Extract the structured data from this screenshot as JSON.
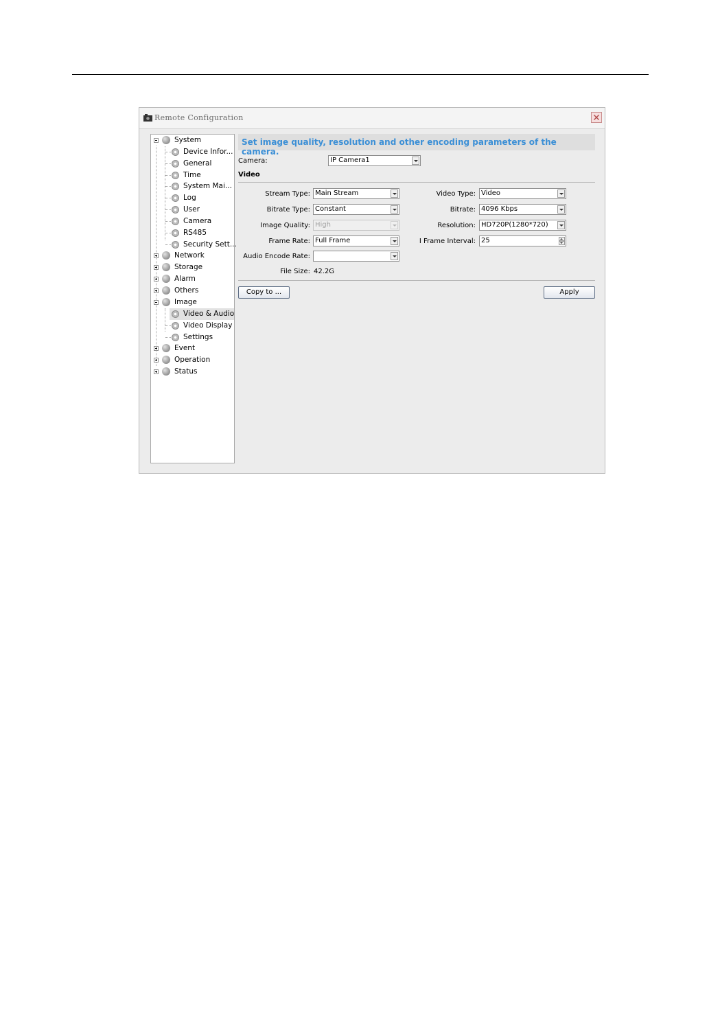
{
  "window": {
    "title": "Remote Configuration"
  },
  "tree": {
    "system": "System",
    "system_children": [
      "Device Infor...",
      "General",
      "Time",
      "System Mai...",
      "Log",
      "User",
      "Camera",
      "RS485",
      "Security Sett..."
    ],
    "network": "Network",
    "storage": "Storage",
    "alarm": "Alarm",
    "others": "Others",
    "image": "Image",
    "image_children": [
      "Video & Audio",
      "Video Display",
      "Settings"
    ],
    "selected": "Video & Audio",
    "event": "Event",
    "operation": "Operation",
    "status": "Status"
  },
  "banner": "Set image quality, resolution and other encoding parameters of the camera.",
  "camera": {
    "label": "Camera:",
    "value": "IP Camera1"
  },
  "section_title": "Video",
  "fields": {
    "stream_type": {
      "label": "Stream Type:",
      "value": "Main Stream"
    },
    "bitrate_type": {
      "label": "Bitrate Type:",
      "value": "Constant"
    },
    "image_quality": {
      "label": "Image Quality:",
      "value": "High"
    },
    "frame_rate": {
      "label": "Frame Rate:",
      "value": "Full Frame"
    },
    "audio_encode_rate": {
      "label": "Audio Encode Rate:",
      "value": ""
    },
    "file_size": {
      "label": "File Size:",
      "value": "42.2G"
    },
    "video_type": {
      "label": "Video Type:",
      "value": "Video"
    },
    "bitrate": {
      "label": "Bitrate:",
      "value": "4096 Kbps"
    },
    "resolution": {
      "label": "Resolution:",
      "value": "HD720P(1280*720)"
    },
    "i_frame_interval": {
      "label": "I Frame Interval:",
      "value": "25"
    }
  },
  "buttons": {
    "copy_to": "Copy to ...",
    "apply": "Apply"
  }
}
